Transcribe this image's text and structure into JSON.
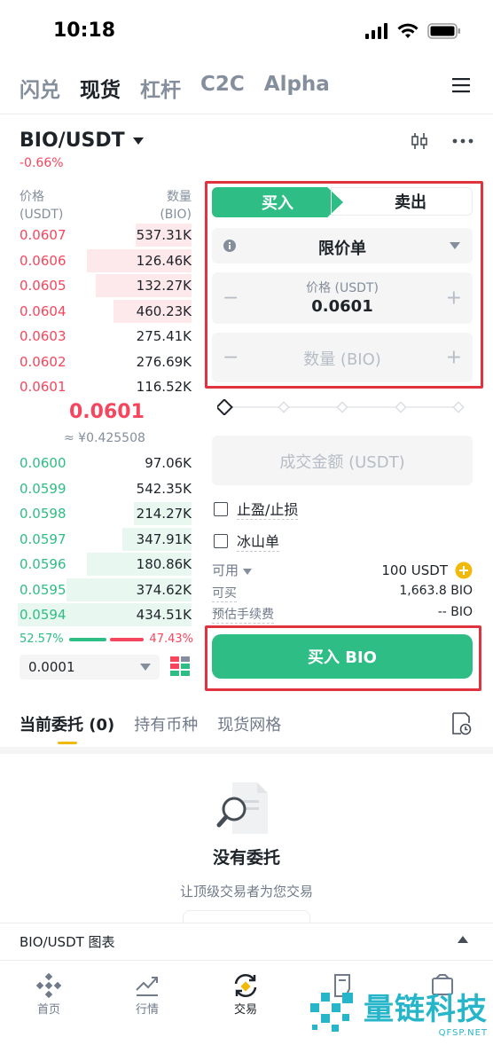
{
  "status": {
    "time": "10:18"
  },
  "nav": {
    "tabs": [
      "闪兑",
      "现货",
      "杠杆",
      "C2C",
      "Alpha"
    ],
    "active_index": 1
  },
  "pair": {
    "symbol": "BIO/USDT",
    "change": "-0.66%"
  },
  "orderbook": {
    "price_header": "价格",
    "price_unit": "(USDT)",
    "qty_header": "数量",
    "qty_unit": "(BIO)",
    "asks": [
      {
        "price": "0.0607",
        "qty": "537.31K",
        "depth": 0.32
      },
      {
        "price": "0.0606",
        "qty": "126.46K",
        "depth": 0.6
      },
      {
        "price": "0.0605",
        "qty": "132.27K",
        "depth": 0.55
      },
      {
        "price": "0.0604",
        "qty": "460.23K",
        "depth": 0.45
      },
      {
        "price": "0.0603",
        "qty": "275.41K",
        "depth": 0
      },
      {
        "price": "0.0602",
        "qty": "276.69K",
        "depth": 0
      },
      {
        "price": "0.0601",
        "qty": "116.52K",
        "depth": 0
      }
    ],
    "mid_price": "0.0601",
    "mid_fiat": "≈ ¥0.425508",
    "bids": [
      {
        "price": "0.0600",
        "qty": "97.06K",
        "depth": 0
      },
      {
        "price": "0.0599",
        "qty": "542.35K",
        "depth": 0
      },
      {
        "price": "0.0598",
        "qty": "214.27K",
        "depth": 0.33
      },
      {
        "price": "0.0597",
        "qty": "347.91K",
        "depth": 0.4
      },
      {
        "price": "0.0596",
        "qty": "180.86K",
        "depth": 0.6
      },
      {
        "price": "0.0595",
        "qty": "374.62K",
        "depth": 0.72
      },
      {
        "price": "0.0594",
        "qty": "434.51K",
        "depth": 1.0
      }
    ],
    "buy_ratio": "52.57%",
    "sell_ratio": "47.43%",
    "precision": "0.0001"
  },
  "form": {
    "buy_tab": "买入",
    "sell_tab": "卖出",
    "order_type": "限价单",
    "price_label": "价格 (USDT)",
    "price_value": "0.0601",
    "qty_placeholder": "数量 (BIO)",
    "total_placeholder": "成交金额 (USDT)",
    "tp_sl": "止盈/止损",
    "iceberg": "冰山单",
    "available_label": "可用",
    "available_value": "100 USDT",
    "can_buy_label": "可买",
    "can_buy_value": "1,663.8 BIO",
    "fee_label": "预估手续费",
    "fee_value": "-- BIO",
    "submit": "买入 BIO"
  },
  "orders": {
    "tabs": [
      "当前委托 (0)",
      "持有币种",
      "现货网格"
    ],
    "empty_title": "没有委托",
    "empty_sub": "让顶级交易者为您交易"
  },
  "chart_bar": {
    "label": "BIO/USDT 图表"
  },
  "tabbar": {
    "items": [
      {
        "label": "首页",
        "icon": "binance-logo-icon"
      },
      {
        "label": "行情",
        "icon": "market-chart-icon"
      },
      {
        "label": "交易",
        "icon": "trade-swap-icon"
      },
      {
        "label": "",
        "icon": "futures-icon"
      },
      {
        "label": "",
        "icon": "wallet-icon"
      }
    ]
  },
  "watermark": {
    "text": "量链科技",
    "url": "QFSP.NET"
  },
  "colors": {
    "buy": "#2ebd85",
    "sell": "#f6465d",
    "accent": "#f0b90b",
    "frame": "#e0333f"
  }
}
